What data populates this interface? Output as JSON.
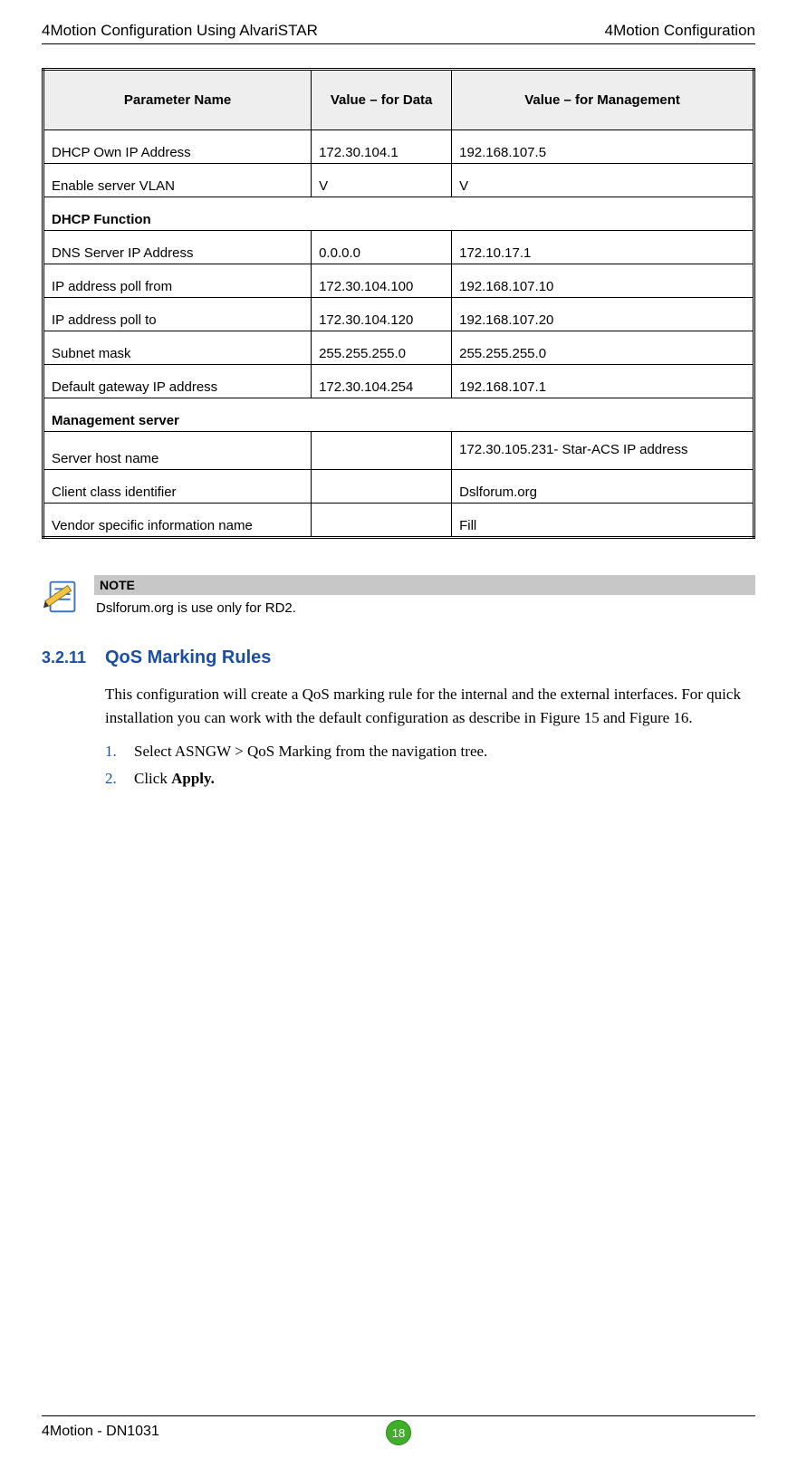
{
  "header": {
    "left": "4Motion Configuration Using AlvariSTAR",
    "right": "4Motion Configuration"
  },
  "table": {
    "columns": [
      "Parameter Name",
      "Value – for Data",
      "Value – for Management"
    ],
    "rows": [
      {
        "cells": [
          "DHCP Own IP Address",
          "172.30.104.1",
          "192.168.107.5"
        ]
      },
      {
        "cells": [
          "Enable server VLAN",
          "V",
          "V"
        ]
      },
      {
        "section": "DHCP  Function"
      },
      {
        "cells": [
          "DNS Server IP Address",
          "0.0.0.0",
          "172.10.17.1"
        ]
      },
      {
        "cells": [
          "IP address poll from",
          "172.30.104.100",
          "192.168.107.10"
        ]
      },
      {
        "cells": [
          "IP address poll to",
          "172.30.104.120",
          "192.168.107.20"
        ]
      },
      {
        "cells": [
          "Subnet mask",
          "255.255.255.0",
          "255.255.255.0"
        ]
      },
      {
        "cells": [
          "Default gateway IP address",
          "172.30.104.254",
          "192.168.107.1"
        ]
      },
      {
        "section": "Management server"
      },
      {
        "cells": [
          "Server host name",
          "",
          "172.30.105.231- Star-ACS IP address"
        ],
        "multiline": true
      },
      {
        "cells": [
          "Client class identifier",
          "",
          "Dslforum.org"
        ]
      },
      {
        "cells": [
          "Vendor specific information name",
          "",
          "Fill"
        ]
      }
    ]
  },
  "note": {
    "title": "NOTE",
    "text": "Dslforum.org is use only for RD2."
  },
  "section": {
    "number": "3.2.11",
    "title": "QoS Marking Rules",
    "paragraph": "This configuration will create a QoS marking rule for the internal and the external interfaces. For quick installation you can work with the default configuration as describe in Figure 15 and Figure 16.",
    "steps": [
      {
        "num": "1.",
        "text": "Select ASNGW > QoS Marking from the navigation tree."
      },
      {
        "num": "2.",
        "prefix": "Click ",
        "bold": "Apply."
      }
    ]
  },
  "footer": {
    "left": "4Motion - DN1031",
    "page": "18"
  }
}
